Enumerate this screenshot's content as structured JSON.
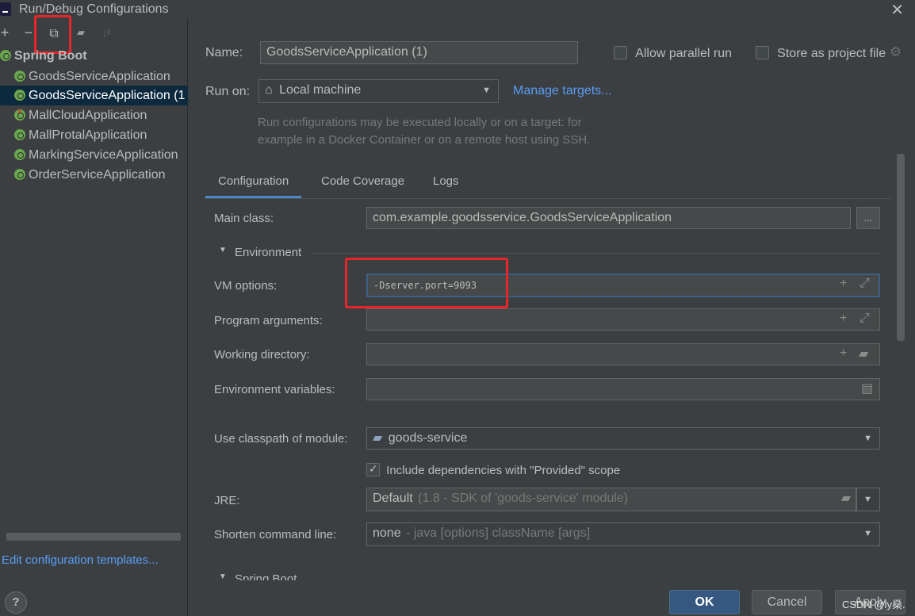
{
  "window": {
    "title": "Run/Debug Configurations",
    "close_label": "✕"
  },
  "toolbar": {
    "add": "+",
    "remove": "−",
    "copy": "⧉",
    "folder": "▰",
    "sort": "↓²"
  },
  "tree": {
    "root": "Spring Boot",
    "items": [
      {
        "label": "GoodsServiceApplication",
        "error": false,
        "selected": false
      },
      {
        "label": "GoodsServiceApplication (1",
        "error": false,
        "selected": true
      },
      {
        "label": "MallCloudApplication",
        "error": true,
        "selected": false
      },
      {
        "label": "MallProtalApplication",
        "error": false,
        "selected": false
      },
      {
        "label": "MarkingServiceApplication",
        "error": false,
        "selected": false
      },
      {
        "label": "OrderServiceApplication",
        "error": false,
        "selected": false
      }
    ]
  },
  "edit_templates": "Edit configuration templates...",
  "help": "?",
  "form": {
    "name_label": "Name:",
    "name_value": "GoodsServiceApplication (1)",
    "allow_parallel": "Allow parallel run",
    "store_project": "Store as project file",
    "run_on_label": "Run on:",
    "run_on_value": "Local machine",
    "manage_targets": "Manage targets...",
    "hint_line1": "Run configurations may be executed locally or on a target: for",
    "hint_line2": "example in a Docker Container or on a remote host using SSH."
  },
  "tabs": [
    {
      "label": "Configuration",
      "active": true
    },
    {
      "label": "Code Coverage",
      "active": false
    },
    {
      "label": "Logs",
      "active": false
    }
  ],
  "config": {
    "main_class_label": "Main class:",
    "main_class_value": "com.example.goodsservice.GoodsServiceApplication",
    "browse": "...",
    "environment_label": "Environment",
    "vm_label": "VM options:",
    "vm_value": "-Dserver.port=9093",
    "program_args_label": "Program arguments:",
    "workdir_label": "Working directory:",
    "envvars_label": "Environment variables:",
    "classpath_label": "Use classpath of module:",
    "classpath_value": "goods-service",
    "include_deps": "Include dependencies with \"Provided\" scope",
    "jre_label": "JRE:",
    "jre_value_main": "Default",
    "jre_value_detail": "(1.8 - SDK of 'goods-service' module)",
    "shorten_label": "Shorten command line:",
    "shorten_value_main": "none",
    "shorten_value_detail": "- java [options] className [args]",
    "spring_boot_section": "Spring Boot"
  },
  "buttons": {
    "ok": "OK",
    "cancel": "Cancel",
    "apply": "Apply"
  },
  "watermark": "CSDN @ly燊."
}
